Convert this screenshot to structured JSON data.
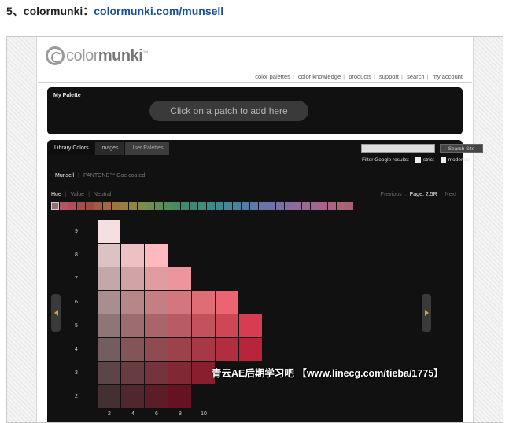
{
  "caption": {
    "prefix": "5、colormunki：",
    "link": "colormunki.com/munsell"
  },
  "site": {
    "logo_light": "color",
    "logo_bold": "munki",
    "logo_tm": "™",
    "nav": [
      "color palettes",
      "color knowledge",
      "products",
      "support",
      "search",
      "my account"
    ]
  },
  "palette": {
    "title": "My Palette",
    "prompt": "Click on a patch to add here"
  },
  "library": {
    "tabs": [
      "Library Colors",
      "Images",
      "User Palettes"
    ],
    "search_button": "Search Site",
    "filter_label": "Filter Google results:",
    "filter_options": [
      "strict",
      "moderate"
    ],
    "systems": [
      "Munsell",
      "PANTONE™ Goe coated"
    ],
    "views": [
      "Hue",
      "Value",
      "Neutral"
    ],
    "pager": {
      "previous": "Previous",
      "page": "Page: 2.5R",
      "next": "Next"
    },
    "hue_strip": [
      "#9a6d73",
      "#b05862",
      "#b34e57",
      "#a34d4e",
      "#9c4b43",
      "#a25a41",
      "#a36a41",
      "#9c7440",
      "#957d43",
      "#8c8544",
      "#818a48",
      "#6e8e4d",
      "#5f8f52",
      "#508d5a",
      "#468c63",
      "#43896c",
      "#418874",
      "#408a7e",
      "#3f8a88",
      "#408991",
      "#44869a",
      "#4a83a0",
      "#527fa5",
      "#5b7ba8",
      "#6577a9",
      "#6f72a8",
      "#7a6ea6",
      "#866ba2",
      "#92699d",
      "#9c6797",
      "#a26590",
      "#a86488",
      "#ab6380",
      "#ac6278",
      "#a86271"
    ],
    "values": [
      "9",
      "8",
      "7",
      "6",
      "5",
      "4",
      "3",
      "2"
    ],
    "chromas": [
      "2",
      "4",
      "6",
      "8",
      "10"
    ],
    "grid": [
      [
        "#f5dfe0"
      ],
      [
        "#dbc3c4",
        "#eec0c3",
        "#ffb9bf"
      ],
      [
        "#c2a8a9",
        "#d2a3a6",
        "#e09ca1",
        "#ed959c"
      ],
      [
        "#a88e8f",
        "#b78689",
        "#c57e84",
        "#d3767e",
        "#e06c76",
        "#ec6471"
      ],
      [
        "#8e7576",
        "#9d6c70",
        "#ab646b",
        "#b85b64",
        "#c4525d",
        "#cf4757",
        "#d83c52"
      ],
      [
        "#745d5e",
        "#835458",
        "#904b52",
        "#9c424b",
        "#a73845",
        "#b02e40",
        "#b8243b"
      ],
      [
        "#5b4547",
        "#693c41",
        "#75333b",
        "#802934",
        "#891e2f"
      ],
      [
        "#442f31",
        "#51262c",
        "#5c1d27",
        "#651322"
      ]
    ]
  },
  "watermark": "青云AE后期学习吧 【www.linecg.com/tieba/1775】"
}
